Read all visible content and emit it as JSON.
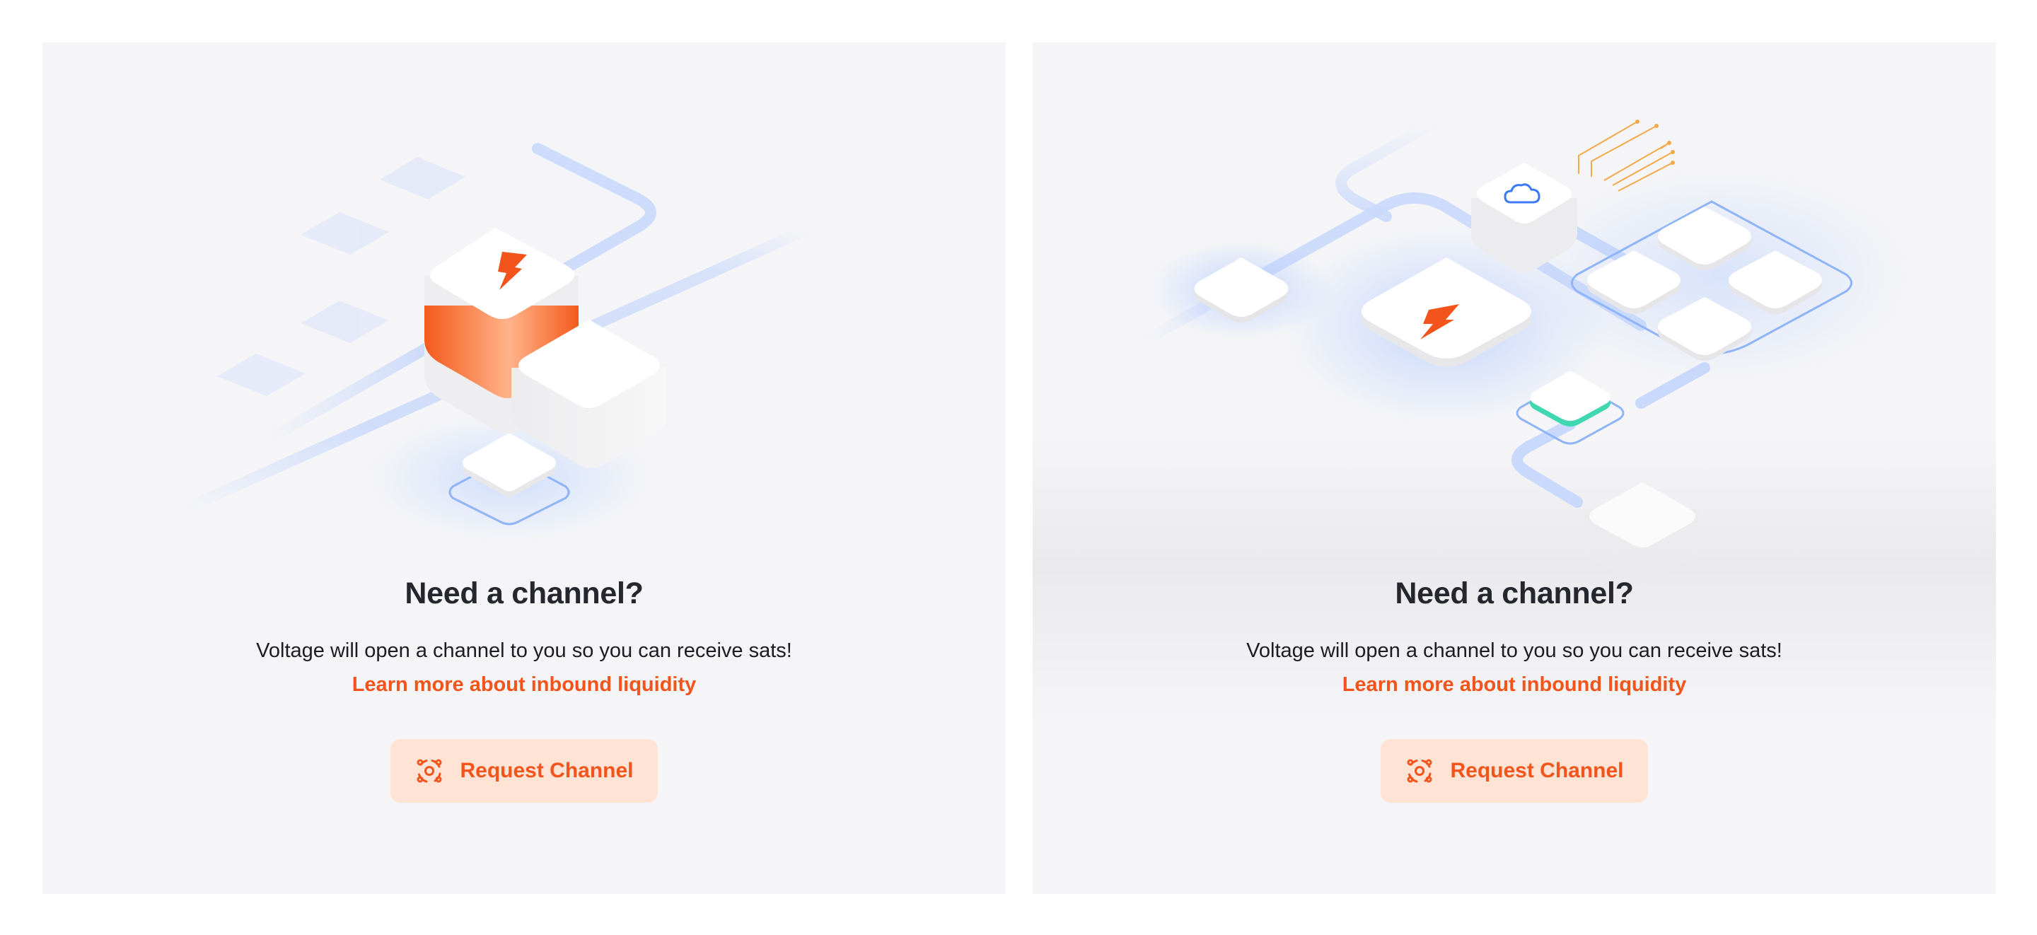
{
  "cards": [
    {
      "title": "Need a channel?",
      "description": "Voltage will open a channel to you so you can receive sats!",
      "link": "Learn more about inbound liquidity",
      "button": {
        "label": "Request Channel",
        "icon": "channel-request-icon"
      }
    },
    {
      "title": "Need a channel?",
      "description": "Voltage will open a channel to you so you can receive sats!",
      "link": "Learn more about inbound liquidity",
      "button": {
        "label": "Request Channel",
        "icon": "channel-request-icon"
      }
    }
  ],
  "colors": {
    "page_background": "#ffffff",
    "card_background": "#f5f5f7",
    "accent": "#f2541b",
    "button_background": "#ffe4d6",
    "title_text": "#25262e",
    "network_blue": "#8fb5f8",
    "node_green": "#3fd8b0",
    "circuit_orange": "#f4a94a"
  }
}
